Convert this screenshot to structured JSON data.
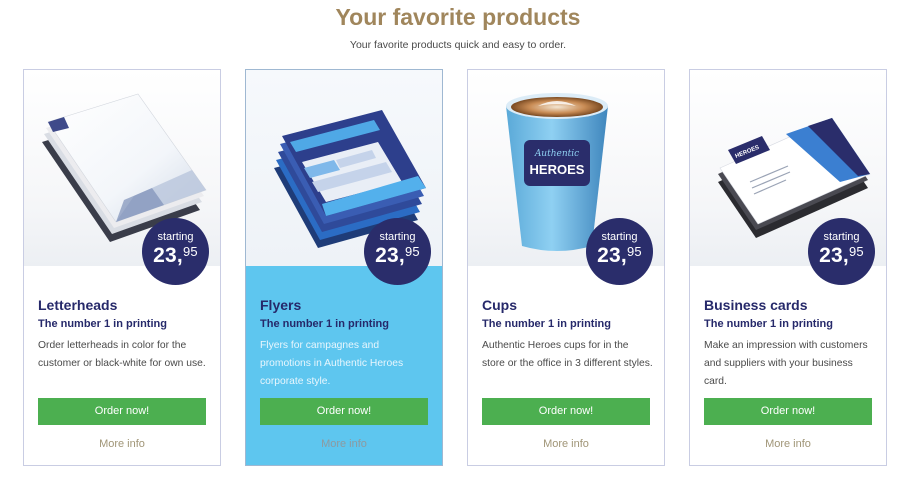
{
  "header": {
    "title": "Your favorite products",
    "subtitle": "Your favorite products quick and easy to order."
  },
  "products": [
    {
      "name": "Letterheads",
      "tagline": "The number 1 in printing",
      "description": "Order letterheads in color for the customer or black-white for own use.",
      "price_label": "starting",
      "price_whole": "23,",
      "price_cents": "95",
      "order_label": "Order now!",
      "more_label": "More info"
    },
    {
      "name": "Flyers",
      "tagline": "The number 1 in printing",
      "description": "Flyers for campagnes and promotions in Authentic Heroes corporate style.",
      "price_label": "starting",
      "price_whole": "23,",
      "price_cents": "95",
      "order_label": "Order now!",
      "more_label": "More info"
    },
    {
      "name": "Cups",
      "tagline": "The number 1 in printing",
      "description": "Authentic Heroes cups for in the store or the office in 3 different styles.",
      "price_label": "starting",
      "price_whole": "23,",
      "price_cents": "95",
      "order_label": "Order now!",
      "more_label": "More info",
      "cup_logo_top": "Authentic",
      "cup_logo_main": "HEROES"
    },
    {
      "name": "Business cards",
      "tagline": "The number 1 in printing",
      "description": "Make an impression with customers and suppliers with your business card.",
      "price_label": "starting",
      "price_whole": "23,",
      "price_cents": "95",
      "order_label": "Order now!",
      "more_label": "More info",
      "card_logo": "HEROES"
    }
  ],
  "colors": {
    "title": "#a0865c",
    "brand_navy": "#2a2d6b",
    "order_button": "#4caf50",
    "highlight_card": "#5ec6ef"
  }
}
